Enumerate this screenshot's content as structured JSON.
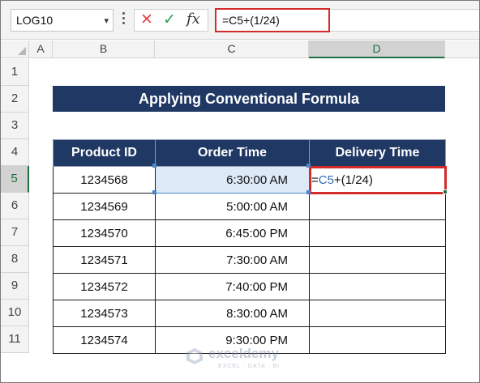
{
  "formula_bar": {
    "name_box": "LOG10",
    "name_box_arrow": "▾",
    "cancel_icon": "✕",
    "enter_icon": "✓",
    "function_icon": "fx",
    "formula": "=C5+(1/24)"
  },
  "columns": [
    "A",
    "B",
    "C",
    "D"
  ],
  "rows": [
    "1",
    "2",
    "3",
    "4",
    "5",
    "6",
    "7",
    "8",
    "9",
    "10",
    "11"
  ],
  "banner_title": "Applying Conventional Formula",
  "table": {
    "headers": [
      "Product ID",
      "Order Time",
      "Delivery Time"
    ],
    "rows": [
      {
        "product_id": "1234568",
        "order_time": "6:30:00 AM",
        "delivery_time": ""
      },
      {
        "product_id": "1234569",
        "order_time": "5:00:00 AM",
        "delivery_time": ""
      },
      {
        "product_id": "1234570",
        "order_time": "6:45:00 PM",
        "delivery_time": ""
      },
      {
        "product_id": "1234571",
        "order_time": "7:30:00 AM",
        "delivery_time": ""
      },
      {
        "product_id": "1234572",
        "order_time": "7:40:00 PM",
        "delivery_time": ""
      },
      {
        "product_id": "1234573",
        "order_time": "8:30:00 AM",
        "delivery_time": ""
      },
      {
        "product_id": "1234574",
        "order_time": "9:30:00 PM",
        "delivery_time": ""
      }
    ],
    "editing_cell": {
      "prefix": "=",
      "reference": "C5",
      "suffix": "+(1/24)"
    }
  },
  "watermark": {
    "name": "exceldemy",
    "tagline": "EXCEL · DATA · BI"
  },
  "colors": {
    "header_fill": "#203864",
    "highlight_red": "#d42a2a",
    "reference_blue": "#2f6db3",
    "selection_green": "#1e7145"
  }
}
